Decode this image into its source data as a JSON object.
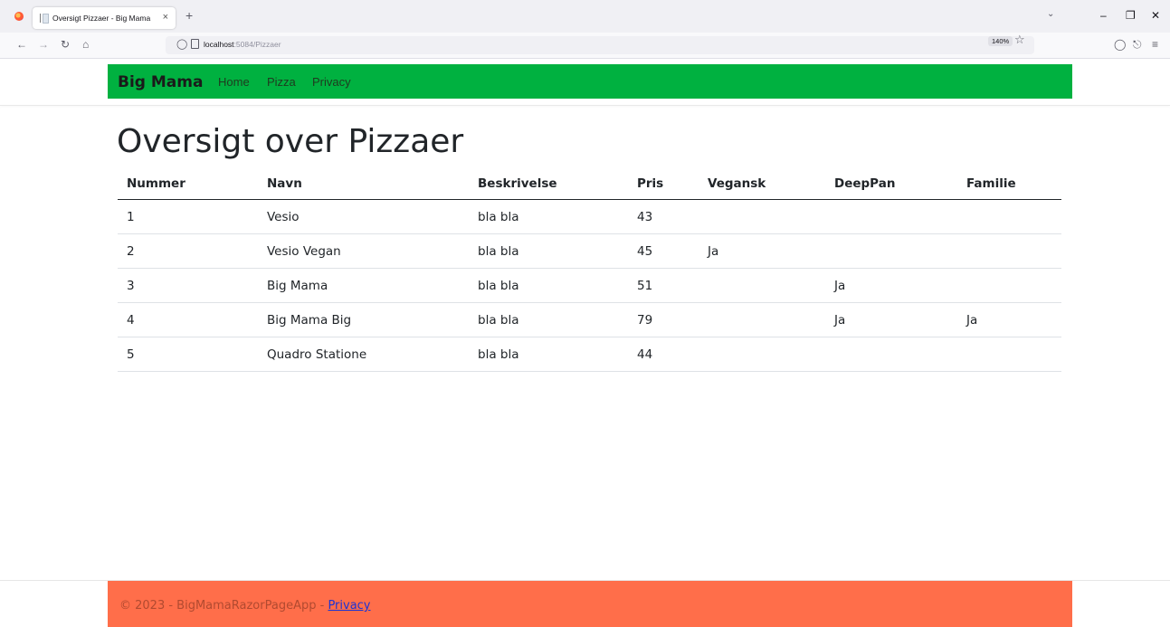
{
  "browser": {
    "tab_title": "Oversigt Pizzaer - Big Mama",
    "tab_close": "×",
    "new_tab": "+",
    "url_host": "localhost",
    "url_path": ":5084/Pizzaer",
    "zoom": "140%"
  },
  "site": {
    "brand": "Big Mama",
    "nav": [
      "Home",
      "Pizza",
      "Privacy"
    ]
  },
  "page": {
    "title": "Oversigt over Pizzaer"
  },
  "table": {
    "headers": [
      "Nummer",
      "Navn",
      "Beskrivelse",
      "Pris",
      "Vegansk",
      "DeepPan",
      "Familie"
    ],
    "rows": [
      [
        "1",
        "Vesio",
        "bla bla",
        "43",
        "",
        "",
        ""
      ],
      [
        "2",
        "Vesio Vegan",
        "bla bla",
        "45",
        "Ja",
        "",
        ""
      ],
      [
        "3",
        "Big Mama",
        "bla bla",
        "51",
        "",
        "Ja",
        ""
      ],
      [
        "4",
        "Big Mama Big",
        "bla bla",
        "79",
        "",
        "Ja",
        "Ja"
      ],
      [
        "5",
        "Quadro Statione",
        "bla bla",
        "44",
        "",
        "",
        ""
      ]
    ]
  },
  "footer": {
    "text": "© 2023 - BigMamaRazorPageApp - ",
    "link": "Privacy"
  },
  "colors": {
    "header_bg": "#00b140",
    "footer_bg": "#ff6e4a"
  }
}
